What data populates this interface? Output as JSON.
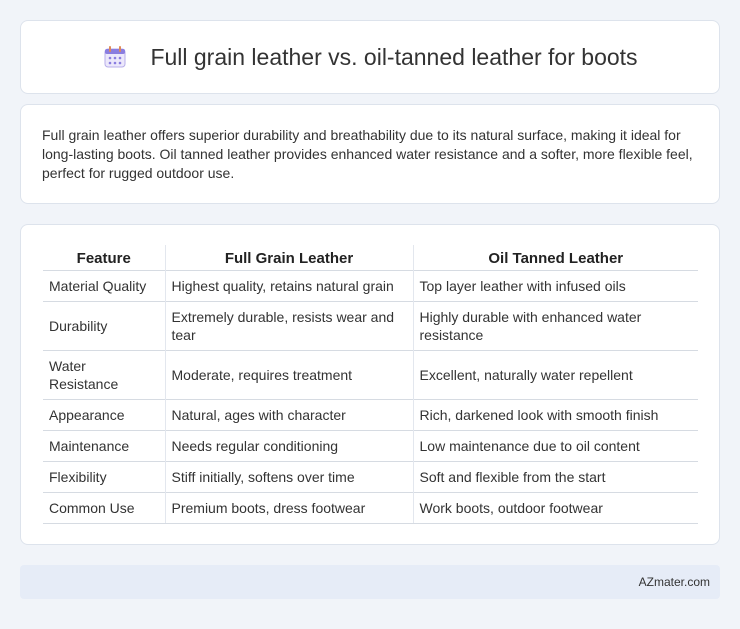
{
  "header": {
    "icon": "calendar-icon",
    "title": "Full grain leather vs. oil-tanned leather for boots"
  },
  "summary": {
    "text": "Full grain leather offers superior durability and breathability due to its natural surface, making it ideal for long-lasting boots. Oil tanned leather provides enhanced water resistance and a softer, more flexible feel, perfect for rugged outdoor use."
  },
  "table": {
    "headers": [
      "Feature",
      "Full Grain Leather",
      "Oil Tanned Leather"
    ],
    "rows": [
      [
        "Material Quality",
        "Highest quality, retains natural grain",
        "Top layer leather with infused oils"
      ],
      [
        "Durability",
        "Extremely durable, resists wear and tear",
        "Highly durable with enhanced water resistance"
      ],
      [
        "Water Resistance",
        "Moderate, requires treatment",
        "Excellent, naturally water repellent"
      ],
      [
        "Appearance",
        "Natural, ages with character",
        "Rich, darkened look with smooth finish"
      ],
      [
        "Maintenance",
        "Needs regular conditioning",
        "Low maintenance due to oil content"
      ],
      [
        "Flexibility",
        "Stiff initially, softens over time",
        "Soft and flexible from the start"
      ],
      [
        "Common Use",
        "Premium boots, dress footwear",
        "Work boots, outdoor footwear"
      ]
    ]
  },
  "footer": {
    "text": "AZmater.com"
  },
  "colors": {
    "background": "#f1f4f9",
    "card": "#ffffff",
    "footer": "#e6ecf7",
    "icon_accent": "#8a7de0"
  }
}
